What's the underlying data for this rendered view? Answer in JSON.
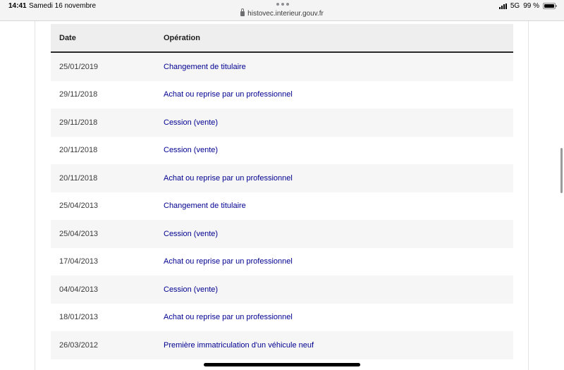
{
  "status_bar": {
    "time": "14:41",
    "date": "Samedi 16 novembre",
    "url": "histovec.interieur.gouv.fr",
    "network": "5G",
    "battery": "99 %",
    "battery_level": 0.99
  },
  "table": {
    "headers": {
      "date": "Date",
      "operation": "Opération"
    },
    "rows": [
      {
        "date": "25/01/2019",
        "operation": "Changement de titulaire"
      },
      {
        "date": "29/11/2018",
        "operation": "Achat ou reprise par un professionnel"
      },
      {
        "date": "29/11/2018",
        "operation": "Cession (vente)"
      },
      {
        "date": "20/11/2018",
        "operation": "Cession (vente)"
      },
      {
        "date": "20/11/2018",
        "operation": "Achat ou reprise par un professionnel"
      },
      {
        "date": "25/04/2013",
        "operation": "Changement de titulaire"
      },
      {
        "date": "25/04/2013",
        "operation": "Cession (vente)"
      },
      {
        "date": "17/04/2013",
        "operation": "Achat ou reprise par un professionnel"
      },
      {
        "date": "04/04/2013",
        "operation": "Cession (vente)"
      },
      {
        "date": "18/01/2013",
        "operation": "Achat ou reprise par un professionnel"
      },
      {
        "date": "26/03/2012",
        "operation": "Première immatriculation d'un véhicule neuf"
      }
    ]
  },
  "colors": {
    "link": "#000091",
    "header_bg": "#eeeeee",
    "row_alt_bg": "#f6f6f6"
  },
  "icons": [
    "lock-icon",
    "signal-icon",
    "battery-icon",
    "tab-dots-icon"
  ]
}
